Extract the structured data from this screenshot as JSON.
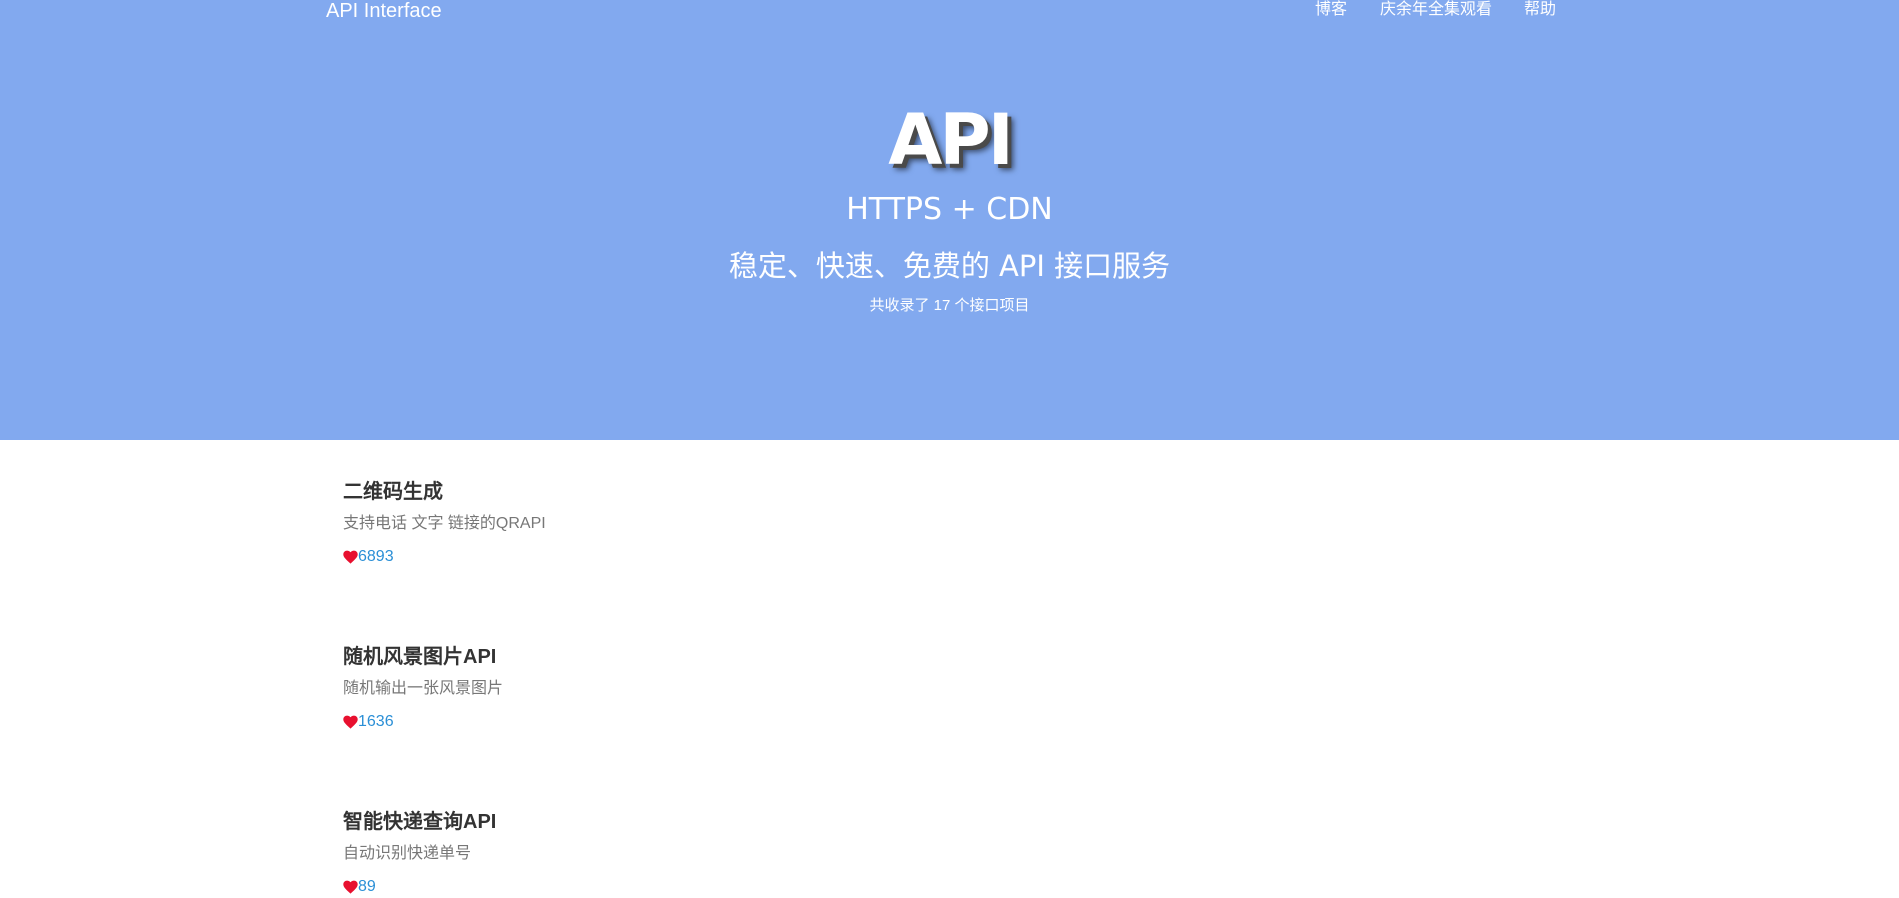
{
  "nav": {
    "brand": "API Interface",
    "links": [
      {
        "label": "博客"
      },
      {
        "label": "庆余年全集观看"
      },
      {
        "label": "帮助"
      }
    ]
  },
  "hero": {
    "title": "API",
    "subtitle": "HTTPS + CDN",
    "description": "稳定、快速、免费的 API 接口服务",
    "count_text": "共收录了 17 个接口项目"
  },
  "apis": [
    {
      "name": "二维码生成",
      "description": "支持电话 文字 链接的QRAPI",
      "likes": "6893"
    },
    {
      "name": "随机风景图片API",
      "description": "随机输出一张风景图片",
      "likes": "1636"
    },
    {
      "name": "智能快递查询API",
      "description": "自动识别快递单号",
      "likes": "89"
    }
  ],
  "colors": {
    "hero_background": "#82a9ef",
    "heart": "#e8102f",
    "like_count": "#2b8fd6"
  },
  "icons": {
    "like": "heart-icon"
  }
}
